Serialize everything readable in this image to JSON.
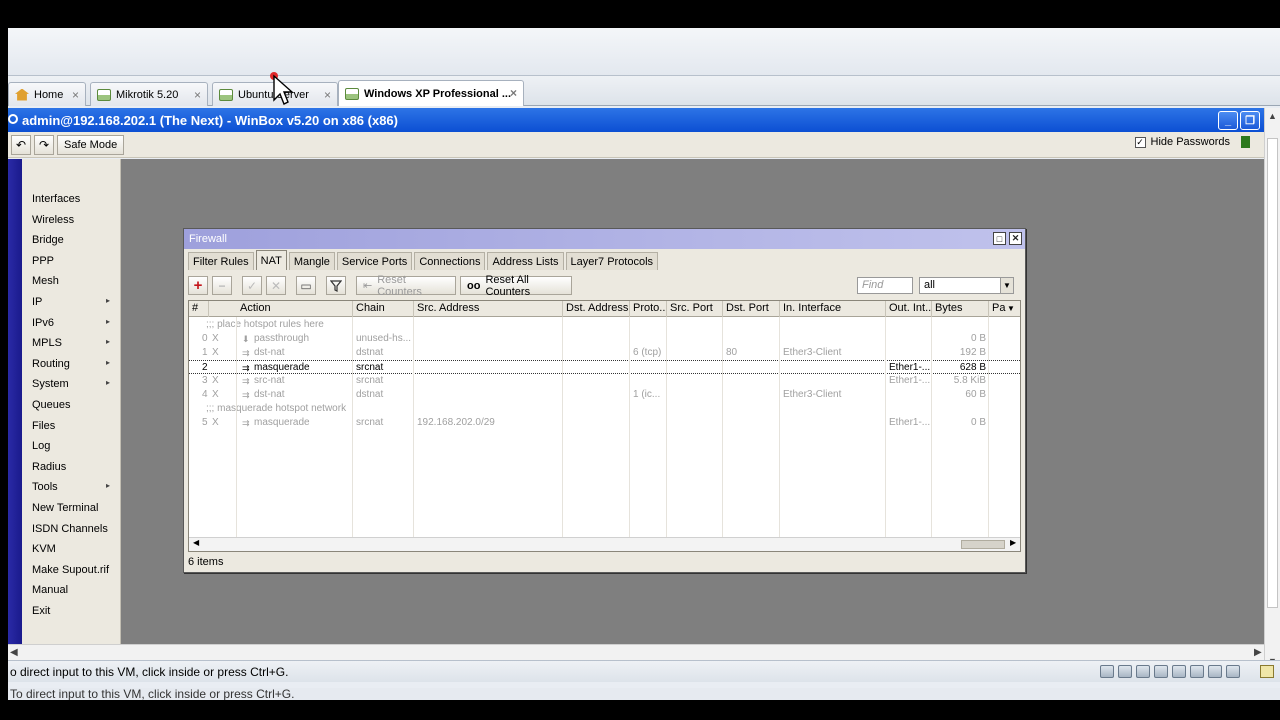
{
  "tabs": [
    {
      "label": "Home",
      "icon": "home-icon"
    },
    {
      "label": "Mikrotik 5.20",
      "icon": "vm-icon"
    },
    {
      "label": "Ubuntu Server",
      "icon": "vm-icon"
    },
    {
      "label": "Windows XP Professional ...",
      "icon": "vm-icon"
    }
  ],
  "tab_close": "×",
  "winbox": {
    "title": "admin@192.168.202.1 (The Next) - WinBox v5.20 on x86 (x86)",
    "safe_mode": "Safe Mode",
    "hide_passwords": "Hide Passwords",
    "hide_passwords_checked": true,
    "undo": "↶",
    "redo": "↷"
  },
  "menu": [
    {
      "label": "Interfaces",
      "submenu": false
    },
    {
      "label": "Wireless",
      "submenu": false
    },
    {
      "label": "Bridge",
      "submenu": false
    },
    {
      "label": "PPP",
      "submenu": false
    },
    {
      "label": "Mesh",
      "submenu": false
    },
    {
      "label": "IP",
      "submenu": true
    },
    {
      "label": "IPv6",
      "submenu": true
    },
    {
      "label": "MPLS",
      "submenu": true
    },
    {
      "label": "Routing",
      "submenu": true
    },
    {
      "label": "System",
      "submenu": true
    },
    {
      "label": "Queues",
      "submenu": false
    },
    {
      "label": "Files",
      "submenu": false
    },
    {
      "label": "Log",
      "submenu": false
    },
    {
      "label": "Radius",
      "submenu": false
    },
    {
      "label": "Tools",
      "submenu": true
    },
    {
      "label": "New Terminal",
      "submenu": false
    },
    {
      "label": "ISDN Channels",
      "submenu": false
    },
    {
      "label": "KVM",
      "submenu": false
    },
    {
      "label": "Make Supout.rif",
      "submenu": false
    },
    {
      "label": "Manual",
      "submenu": false
    },
    {
      "label": "Exit",
      "submenu": false
    }
  ],
  "firewall": {
    "title": "Firewall",
    "tabs": [
      "Filter Rules",
      "NAT",
      "Mangle",
      "Service Ports",
      "Connections",
      "Address Lists",
      "Layer7 Protocols"
    ],
    "active_tab": "NAT",
    "reset_counters": "Reset Counters",
    "reset_all_counters": "Reset All Counters",
    "find_placeholder": "Find",
    "filter_value": "all",
    "columns": [
      "#",
      "Action",
      "Chain",
      "Src. Address",
      "Dst. Address",
      "Proto...",
      "Src. Port",
      "Dst. Port",
      "In. Interface",
      "Out. Int...",
      "Bytes",
      "Pa"
    ],
    "rows": [
      {
        "type": "comment",
        "text": ";;; place hotspot rules here"
      },
      {
        "num": "0",
        "flag": "X",
        "action": "passthrough",
        "chain": "unused-hs...",
        "src": "",
        "proto": "",
        "dport": "",
        "inif": "",
        "outif": "",
        "bytes": "0 B",
        "disabled": true
      },
      {
        "num": "1",
        "flag": "X",
        "action": "dst-nat",
        "chain": "dstnat",
        "src": "",
        "proto": "6 (tcp)",
        "dport": "80",
        "inif": "Ether3-Client",
        "outif": "",
        "bytes": "192 B",
        "disabled": true
      },
      {
        "num": "2",
        "flag": "",
        "action": "masquerade",
        "chain": "srcnat",
        "src": "",
        "proto": "",
        "dport": "",
        "inif": "",
        "outif": "Ether1-...",
        "bytes": "628 B",
        "disabled": false
      },
      {
        "num": "3",
        "flag": "X",
        "action": "src-nat",
        "chain": "srcnat",
        "src": "",
        "proto": "",
        "dport": "",
        "inif": "",
        "outif": "Ether1-...",
        "bytes": "5.8 KiB",
        "disabled": true
      },
      {
        "num": "4",
        "flag": "X",
        "action": "dst-nat",
        "chain": "dstnat",
        "src": "",
        "proto": "1 (ic...",
        "dport": "",
        "inif": "Ether3-Client",
        "outif": "",
        "bytes": "60 B",
        "disabled": true
      },
      {
        "type": "comment",
        "text": ";;; masquerade hotspot network"
      },
      {
        "num": "5",
        "flag": "X",
        "action": "masquerade",
        "chain": "srcnat",
        "src": "192.168.202.0/29",
        "proto": "",
        "dport": "",
        "inif": "",
        "outif": "Ether1-...",
        "bytes": "0 B",
        "disabled": true
      }
    ],
    "status": "6 items"
  },
  "statusbar": {
    "text": "o direct input to this VM, click inside or press Ctrl+G.",
    "text2": "To direct input to this VM, click inside or press Ctrl+G."
  },
  "colors": {
    "titlebar": "#0c4fd3",
    "menu_stripe": "#1a1a8c",
    "desktop": "#7f7f7f",
    "firewall_title": "#9ea0dc"
  }
}
